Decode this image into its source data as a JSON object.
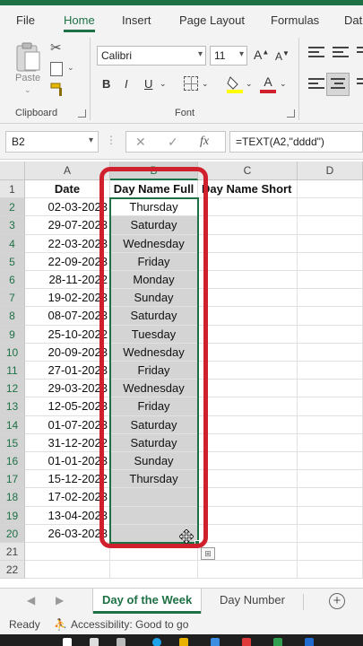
{
  "ribbon_tabs": [
    "File",
    "Home",
    "Insert",
    "Page Layout",
    "Formulas",
    "Dat"
  ],
  "ribbon": {
    "clipboard": {
      "paste_label": "Paste",
      "group_label": "Clipboard"
    },
    "font": {
      "font_name": "Calibri",
      "font_size": "11",
      "bold": "B",
      "italic": "I",
      "underline": "U",
      "group_label": "Font"
    }
  },
  "formula_bar": {
    "name_box": "B2",
    "fx": "fx",
    "formula": "=TEXT(A2,\"dddd\")"
  },
  "columns": [
    "A",
    "B",
    "C",
    "D"
  ],
  "header_row": {
    "row": "1",
    "A": "Date",
    "B": "Day Name Full",
    "C": "Day Name Short"
  },
  "rows": [
    {
      "row": "2",
      "date": "02-03-2023",
      "day": "Thursday"
    },
    {
      "row": "3",
      "date": "29-07-2023",
      "day": "Saturday"
    },
    {
      "row": "4",
      "date": "22-03-2023",
      "day": "Wednesday"
    },
    {
      "row": "5",
      "date": "22-09-2023",
      "day": "Friday"
    },
    {
      "row": "6",
      "date": "28-11-2022",
      "day": "Monday"
    },
    {
      "row": "7",
      "date": "19-02-2023",
      "day": "Sunday"
    },
    {
      "row": "8",
      "date": "08-07-2023",
      "day": "Saturday"
    },
    {
      "row": "9",
      "date": "25-10-2022",
      "day": "Tuesday"
    },
    {
      "row": "10",
      "date": "20-09-2023",
      "day": "Wednesday"
    },
    {
      "row": "11",
      "date": "27-01-2023",
      "day": "Friday"
    },
    {
      "row": "12",
      "date": "29-03-2023",
      "day": "Wednesday"
    },
    {
      "row": "13",
      "date": "12-05-2023",
      "day": "Friday"
    },
    {
      "row": "14",
      "date": "01-07-2023",
      "day": "Saturday"
    },
    {
      "row": "15",
      "date": "31-12-2022",
      "day": "Saturday"
    },
    {
      "row": "16",
      "date": "01-01-2023",
      "day": "Sunday"
    },
    {
      "row": "17",
      "date": "15-12-2022",
      "day": "Thursday"
    },
    {
      "row": "18",
      "date": "17-02-2023",
      "day": ""
    },
    {
      "row": "19",
      "date": "13-04-2023",
      "day": ""
    },
    {
      "row": "20",
      "date": "26-03-2023",
      "day": ""
    },
    {
      "row": "21",
      "date": "",
      "day": ""
    },
    {
      "row": "22",
      "date": "",
      "day": ""
    }
  ],
  "sheet_tabs": [
    "Day of the Week",
    "Day Number"
  ],
  "status": {
    "ready": "Ready",
    "accessibility": "Accessibility: Good to go"
  },
  "colors": {
    "accent": "#1e7145",
    "highlight_box": "#d0202e",
    "selection_fill": "#d4d4d4"
  }
}
